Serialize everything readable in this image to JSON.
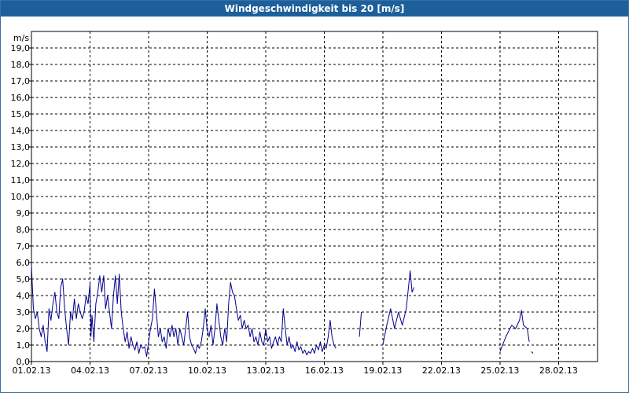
{
  "colors": {
    "titlebar_bg": "#1c5f9b",
    "titlebar_text": "#ffffff",
    "frame_border": "#3a6ea5",
    "grid": "#000000",
    "line": "#00008b"
  },
  "chart_data": {
    "type": "line",
    "title": "Windgeschwindigkeit bis 20 [m/s]",
    "ylabel": "m/s",
    "xlabel": "",
    "ylim": [
      0,
      20
    ],
    "y_ticks": [
      "0,0",
      "1,0",
      "2,0",
      "3,0",
      "4,0",
      "5,0",
      "6,0",
      "7,0",
      "8,0",
      "9,0",
      "10,0",
      "11,0",
      "12,0",
      "13,0",
      "14,0",
      "15,0",
      "16,0",
      "17,0",
      "18,0",
      "19,0"
    ],
    "y_tick_values": [
      0,
      1,
      2,
      3,
      4,
      5,
      6,
      7,
      8,
      9,
      10,
      11,
      12,
      13,
      14,
      15,
      16,
      17,
      18,
      19
    ],
    "x_range_days": [
      0,
      29
    ],
    "x_ticks": [
      {
        "label": "01.02.13",
        "day": 0
      },
      {
        "label": "04.02.13",
        "day": 3
      },
      {
        "label": "07.02.13",
        "day": 6
      },
      {
        "label": "10.02.13",
        "day": 9
      },
      {
        "label": "13.02.13",
        "day": 12
      },
      {
        "label": "16.02.13",
        "day": 15
      },
      {
        "label": "19.02.13",
        "day": 18
      },
      {
        "label": "22.02.13",
        "day": 21
      },
      {
        "label": "25.02.13",
        "day": 24
      },
      {
        "label": "28.02.13",
        "day": 27
      }
    ],
    "grid": true,
    "series": [
      {
        "segments": [
          [
            [
              0.0,
              5.8
            ],
            [
              0.1,
              3.2
            ],
            [
              0.2,
              2.6
            ],
            [
              0.3,
              3.0
            ],
            [
              0.4,
              2.0
            ],
            [
              0.5,
              1.5
            ],
            [
              0.6,
              2.2
            ],
            [
              0.7,
              1.2
            ],
            [
              0.8,
              0.6
            ],
            [
              0.9,
              3.2
            ],
            [
              1.0,
              2.5
            ],
            [
              1.1,
              3.5
            ],
            [
              1.2,
              4.2
            ],
            [
              1.3,
              3.0
            ],
            [
              1.4,
              2.6
            ],
            [
              1.5,
              4.5
            ],
            [
              1.6,
              5.0
            ],
            [
              1.7,
              3.2
            ],
            [
              1.8,
              2.0
            ],
            [
              1.9,
              1.0
            ],
            [
              2.0,
              3.0
            ],
            [
              2.1,
              2.5
            ],
            [
              2.2,
              3.8
            ],
            [
              2.3,
              2.6
            ],
            [
              2.4,
              3.5
            ],
            [
              2.5,
              3.0
            ],
            [
              2.6,
              2.6
            ],
            [
              2.7,
              3.0
            ],
            [
              2.8,
              4.0
            ],
            [
              2.9,
              3.5
            ],
            [
              3.0,
              4.7
            ],
            [
              3.05,
              1.5
            ],
            [
              3.1,
              2.8
            ],
            [
              3.2,
              1.2
            ],
            [
              3.3,
              3.5
            ],
            [
              3.4,
              4.2
            ],
            [
              3.5,
              5.2
            ],
            [
              3.6,
              4.2
            ],
            [
              3.7,
              5.2
            ],
            [
              3.8,
              3.2
            ],
            [
              3.9,
              4.0
            ],
            [
              4.0,
              3.0
            ],
            [
              4.1,
              2.0
            ],
            [
              4.2,
              4.0
            ],
            [
              4.3,
              5.2
            ],
            [
              4.4,
              3.5
            ],
            [
              4.5,
              5.3
            ],
            [
              4.6,
              3.0
            ],
            [
              4.7,
              2.0
            ],
            [
              4.8,
              1.2
            ],
            [
              4.9,
              1.8
            ],
            [
              5.0,
              0.8
            ],
            [
              5.1,
              1.5
            ],
            [
              5.2,
              1.0
            ],
            [
              5.3,
              0.7
            ],
            [
              5.4,
              1.2
            ],
            [
              5.5,
              0.5
            ],
            [
              5.6,
              1.0
            ],
            [
              5.7,
              0.8
            ],
            [
              5.8,
              0.9
            ],
            [
              5.9,
              0.3
            ],
            [
              6.0,
              1.2
            ],
            [
              6.1,
              2.0
            ],
            [
              6.2,
              2.6
            ],
            [
              6.3,
              4.4
            ],
            [
              6.4,
              3.0
            ],
            [
              6.5,
              1.5
            ],
            [
              6.6,
              2.0
            ],
            [
              6.7,
              1.2
            ],
            [
              6.8,
              1.5
            ],
            [
              6.9,
              0.8
            ],
            [
              7.0,
              2.0
            ],
            [
              7.1,
              1.5
            ],
            [
              7.2,
              2.2
            ],
            [
              7.3,
              1.5
            ],
            [
              7.4,
              2.0
            ],
            [
              7.5,
              1.0
            ],
            [
              7.6,
              2.0
            ],
            [
              7.7,
              1.5
            ],
            [
              7.8,
              1.0
            ],
            [
              7.9,
              2.0
            ],
            [
              8.0,
              3.0
            ],
            [
              8.1,
              1.5
            ],
            [
              8.2,
              1.0
            ],
            [
              8.3,
              0.8
            ],
            [
              8.4,
              0.5
            ],
            [
              8.5,
              1.0
            ],
            [
              8.6,
              0.8
            ],
            [
              8.7,
              1.2
            ],
            [
              8.8,
              2.0
            ],
            [
              8.9,
              3.2
            ],
            [
              9.0,
              2.0
            ],
            [
              9.1,
              1.5
            ],
            [
              9.2,
              2.2
            ],
            [
              9.3,
              1.0
            ],
            [
              9.4,
              2.0
            ],
            [
              9.5,
              3.5
            ],
            [
              9.6,
              2.5
            ],
            [
              9.7,
              1.5
            ],
            [
              9.8,
              1.0
            ],
            [
              9.9,
              2.0
            ],
            [
              10.0,
              1.2
            ],
            [
              10.1,
              3.5
            ],
            [
              10.2,
              4.8
            ],
            [
              10.3,
              4.2
            ],
            [
              10.4,
              4.0
            ],
            [
              10.5,
              3.2
            ],
            [
              10.6,
              2.5
            ],
            [
              10.7,
              2.8
            ],
            [
              10.8,
              2.0
            ],
            [
              10.9,
              2.5
            ],
            [
              11.0,
              2.0
            ],
            [
              11.1,
              2.2
            ],
            [
              11.2,
              1.5
            ],
            [
              11.3,
              2.0
            ],
            [
              11.4,
              1.2
            ],
            [
              11.5,
              1.5
            ],
            [
              11.6,
              1.0
            ],
            [
              11.7,
              1.8
            ],
            [
              11.8,
              1.2
            ],
            [
              11.9,
              1.0
            ],
            [
              12.0,
              2.0
            ],
            [
              12.1,
              1.2
            ],
            [
              12.2,
              1.5
            ],
            [
              12.3,
              0.8
            ],
            [
              12.4,
              1.2
            ],
            [
              12.5,
              1.5
            ],
            [
              12.6,
              1.0
            ],
            [
              12.7,
              1.5
            ],
            [
              12.8,
              1.2
            ],
            [
              12.9,
              3.2
            ],
            [
              13.0,
              2.0
            ],
            [
              13.1,
              1.0
            ],
            [
              13.2,
              1.5
            ],
            [
              13.3,
              0.8
            ],
            [
              13.4,
              1.0
            ],
            [
              13.5,
              0.6
            ],
            [
              13.6,
              1.2
            ],
            [
              13.7,
              0.7
            ],
            [
              13.8,
              0.9
            ],
            [
              13.9,
              0.5
            ],
            [
              14.0,
              0.7
            ],
            [
              14.1,
              0.4
            ],
            [
              14.2,
              0.6
            ],
            [
              14.3,
              0.5
            ],
            [
              14.4,
              0.8
            ],
            [
              14.5,
              0.5
            ],
            [
              14.6,
              1.0
            ],
            [
              14.7,
              0.7
            ],
            [
              14.8,
              1.2
            ],
            [
              14.9,
              0.6
            ],
            [
              15.0,
              1.0
            ],
            [
              15.1,
              0.8
            ],
            [
              15.2,
              1.5
            ],
            [
              15.3,
              2.5
            ],
            [
              15.4,
              1.5
            ],
            [
              15.5,
              1.0
            ],
            [
              15.6,
              0.8
            ]
          ],
          [
            [
              16.8,
              1.5
            ],
            [
              16.9,
              3.0
            ]
          ],
          [
            [
              18.0,
              1.0
            ],
            [
              18.2,
              2.2
            ],
            [
              18.4,
              3.2
            ],
            [
              18.6,
              2.0
            ],
            [
              18.8,
              3.0
            ],
            [
              19.0,
              2.2
            ],
            [
              19.2,
              3.2
            ],
            [
              19.4,
              5.5
            ],
            [
              19.5,
              4.2
            ],
            [
              19.6,
              4.5
            ]
          ],
          [
            [
              24.0,
              0.6
            ],
            [
              24.3,
              1.5
            ],
            [
              24.6,
              2.2
            ],
            [
              24.8,
              2.0
            ],
            [
              25.0,
              2.5
            ],
            [
              25.1,
              3.1
            ],
            [
              25.2,
              2.2
            ],
            [
              25.4,
              2.0
            ],
            [
              25.5,
              1.2
            ]
          ],
          [
            [
              25.6,
              0.6
            ],
            [
              25.7,
              0.5
            ]
          ]
        ]
      }
    ]
  }
}
